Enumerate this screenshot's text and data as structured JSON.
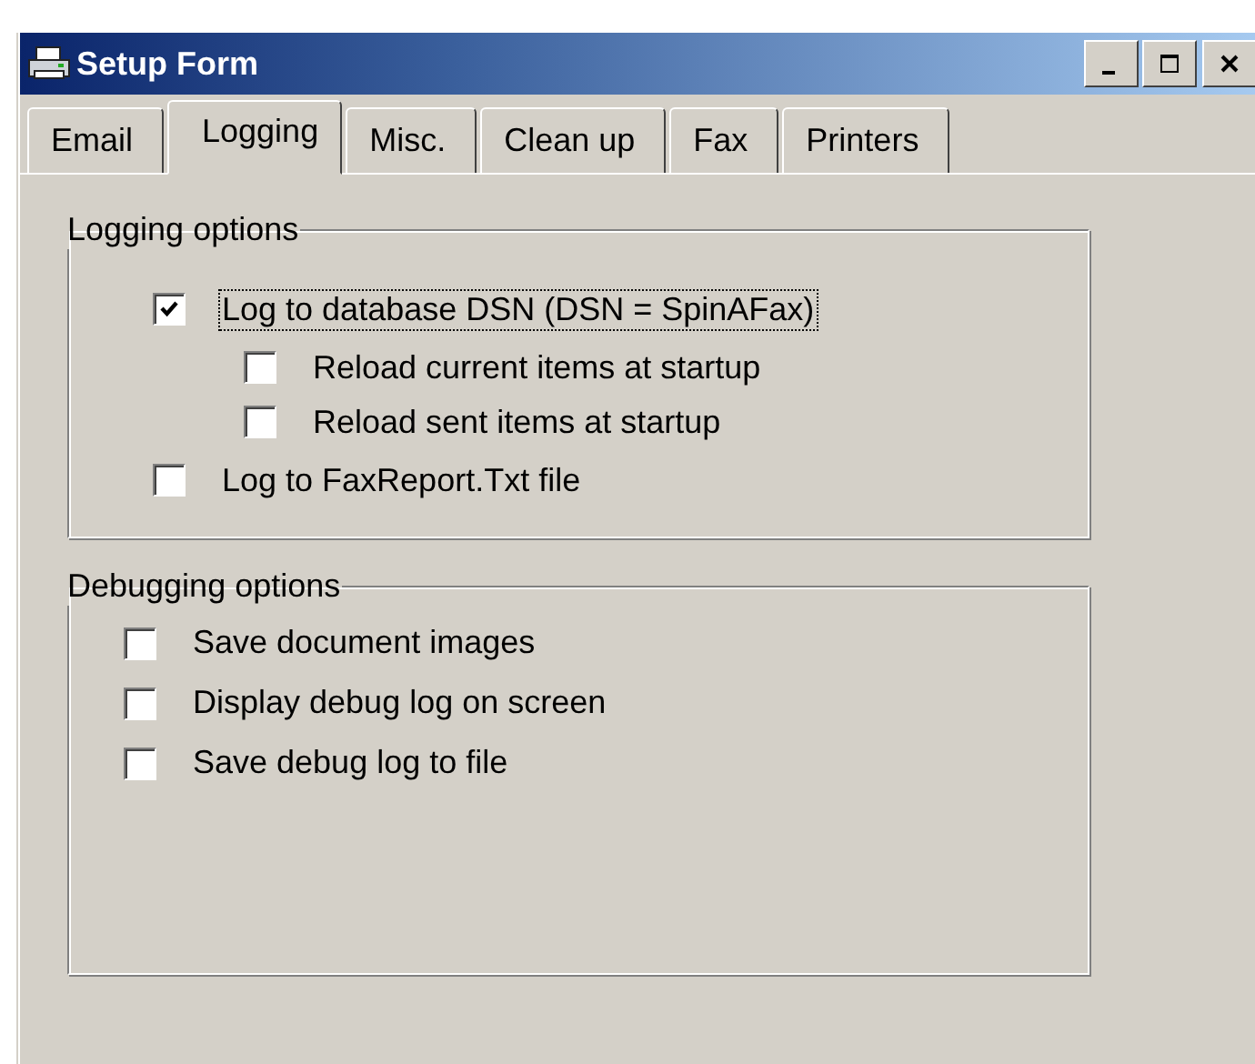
{
  "window": {
    "title": "Setup Form"
  },
  "tabs": [
    {
      "label": "Email",
      "selected": false
    },
    {
      "label": "Logging",
      "selected": true
    },
    {
      "label": "Misc.",
      "selected": false
    },
    {
      "label": "Clean up",
      "selected": false
    },
    {
      "label": "Fax",
      "selected": false
    },
    {
      "label": "Printers",
      "selected": false
    }
  ],
  "groups": [
    {
      "title": "Logging options",
      "items": [
        {
          "label": "Log to database DSN (DSN = SpinAFax)",
          "checked": true,
          "focused": true,
          "children": [
            {
              "label": "Reload current items at startup",
              "checked": false,
              "focused": false
            },
            {
              "label": "Reload sent items at startup",
              "checked": false,
              "focused": false
            }
          ]
        },
        {
          "label": "Log to FaxReport.Txt file",
          "checked": false,
          "focused": false
        }
      ]
    },
    {
      "title": "Debugging options",
      "items": [
        {
          "label": "Save document images",
          "checked": false,
          "focused": false
        },
        {
          "label": "Display debug log on screen",
          "checked": false,
          "focused": false
        },
        {
          "label": "Save debug log to file",
          "checked": false,
          "focused": false
        }
      ]
    }
  ]
}
